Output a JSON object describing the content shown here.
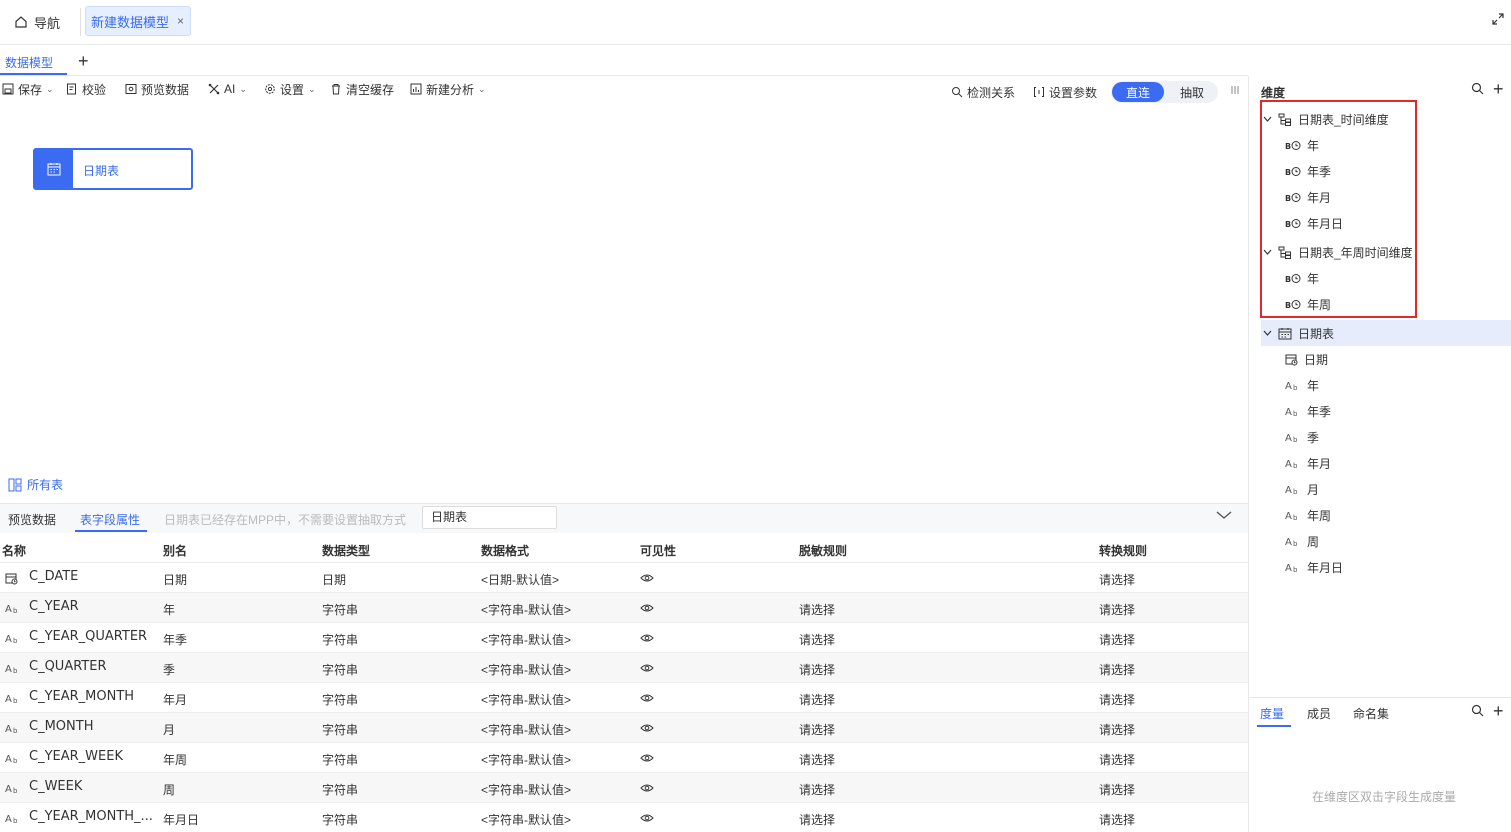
{
  "top_tabs": {
    "nav_label": "导航",
    "model_tab_label": "新建数据模型",
    "close_glyph": "×"
  },
  "sub_tabs": {
    "model_label": "数据模型",
    "add_glyph": "+"
  },
  "toolbar": {
    "save": "保存",
    "validate": "校验",
    "preview": "预览数据",
    "ai": "AI",
    "settings": "设置",
    "clear_cache": "清空缓存",
    "new_analysis": "新建分析",
    "detect_relations": "检测关系",
    "set_params": "设置参数",
    "mode_direct": "直连",
    "mode_extract": "抽取",
    "selected_mode": "直连"
  },
  "canvas": {
    "node_label": "日期表",
    "all_tables": "所有表"
  },
  "bottom": {
    "tab_preview": "预览数据",
    "tab_fields": "表字段属性",
    "note": "日期表已经存在MPP中，不需要设置抽取方式",
    "table_select_value": "日期表",
    "columns": [
      "名称",
      "别名",
      "数据类型",
      "数据格式",
      "可见性",
      "脱敏规则",
      "转换规则"
    ],
    "rows": [
      {
        "name": "C_DATE",
        "alias": "日期",
        "type": "日期",
        "format": "<日期-默认值>",
        "mask": "",
        "convert": "请选择",
        "icon": "calendar-icon"
      },
      {
        "name": "C_YEAR",
        "alias": "年",
        "type": "字符串",
        "format": "<字符串-默认值>",
        "mask": "请选择",
        "convert": "请选择",
        "icon": "text-type-icon"
      },
      {
        "name": "C_YEAR_QUARTER",
        "alias": "年季",
        "type": "字符串",
        "format": "<字符串-默认值>",
        "mask": "请选择",
        "convert": "请选择",
        "icon": "text-type-icon"
      },
      {
        "name": "C_QUARTER",
        "alias": "季",
        "type": "字符串",
        "format": "<字符串-默认值>",
        "mask": "请选择",
        "convert": "请选择",
        "icon": "text-type-icon"
      },
      {
        "name": "C_YEAR_MONTH",
        "alias": "年月",
        "type": "字符串",
        "format": "<字符串-默认值>",
        "mask": "请选择",
        "convert": "请选择",
        "icon": "text-type-icon"
      },
      {
        "name": "C_MONTH",
        "alias": "月",
        "type": "字符串",
        "format": "<字符串-默认值>",
        "mask": "请选择",
        "convert": "请选择",
        "icon": "text-type-icon"
      },
      {
        "name": "C_YEAR_WEEK",
        "alias": "年周",
        "type": "字符串",
        "format": "<字符串-默认值>",
        "mask": "请选择",
        "convert": "请选择",
        "icon": "text-type-icon"
      },
      {
        "name": "C_WEEK",
        "alias": "周",
        "type": "字符串",
        "format": "<字符串-默认值>",
        "mask": "请选择",
        "convert": "请选择",
        "icon": "text-type-icon"
      },
      {
        "name": "C_YEAR_MONTH_...",
        "alias": "年月日",
        "type": "字符串",
        "format": "<字符串-默认值>",
        "mask": "请选择",
        "convert": "请选择",
        "icon": "text-type-icon"
      }
    ]
  },
  "dimension_panel": {
    "title": "维度",
    "hierarchy_1": {
      "label": "日期表_时间维度",
      "levels": [
        "年",
        "年季",
        "年月",
        "年月日"
      ]
    },
    "hierarchy_2": {
      "label": "日期表_年周时间维度",
      "levels": [
        "年",
        "年周"
      ]
    },
    "table": {
      "label": "日期表",
      "fields": [
        "日期",
        "年",
        "年季",
        "季",
        "年月",
        "月",
        "年周",
        "周",
        "年月日"
      ]
    }
  },
  "measure_panel": {
    "tab_measure": "度量",
    "tab_members": "成员",
    "tab_named_sets": "命名集",
    "empty_hint": "在维度区双击字段生成度量"
  },
  "colors": {
    "accent": "#3a6bf0",
    "highlight_border": "#e02a2a",
    "selected_row": "#e6ecfb"
  }
}
